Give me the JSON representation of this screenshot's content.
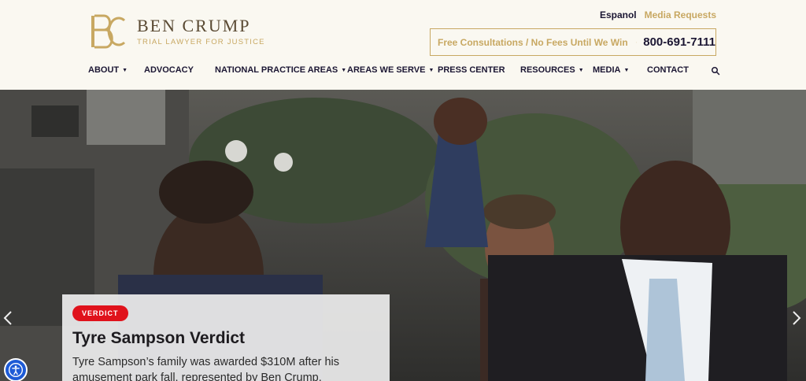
{
  "brand": {
    "name": "BEN CRUMP",
    "tagline": "TRIAL LAWYER FOR JUSTICE",
    "monogram": "BC",
    "color_gold": "#c8a862",
    "color_navy": "#1b1633"
  },
  "topbar": {
    "language_link": "Espanol",
    "media_link": "Media Requests"
  },
  "cta": {
    "text": "Free Consultations / No Fees Until We Win",
    "phone_icon": "phone-icon",
    "phone": "800-691-7111"
  },
  "nav": {
    "items": [
      {
        "label": "ABOUT",
        "dropdown": true
      },
      {
        "label": "ADVOCACY",
        "dropdown": false
      },
      {
        "label": "NATIONAL PRACTICE AREAS",
        "dropdown": true
      },
      {
        "label": "AREAS WE SERVE",
        "dropdown": true
      },
      {
        "label": "PRESS CENTER",
        "dropdown": false
      },
      {
        "label": "RESOURCES",
        "dropdown": true
      },
      {
        "label": "MEDIA",
        "dropdown": true
      },
      {
        "label": "CONTACT",
        "dropdown": false
      }
    ],
    "search_icon": "search-icon"
  },
  "hero": {
    "badge": "VERDICT",
    "title": "Tyre Sampson Verdict",
    "text": "Tyre Sampson’s family was awarded $310M after his amusement park fall, represented by Ben Crump.",
    "prev_icon": "chevron-left-icon",
    "next_icon": "chevron-right-icon",
    "badge_color": "#e0121b"
  },
  "accessibility": {
    "icon": "accessibility-icon"
  }
}
